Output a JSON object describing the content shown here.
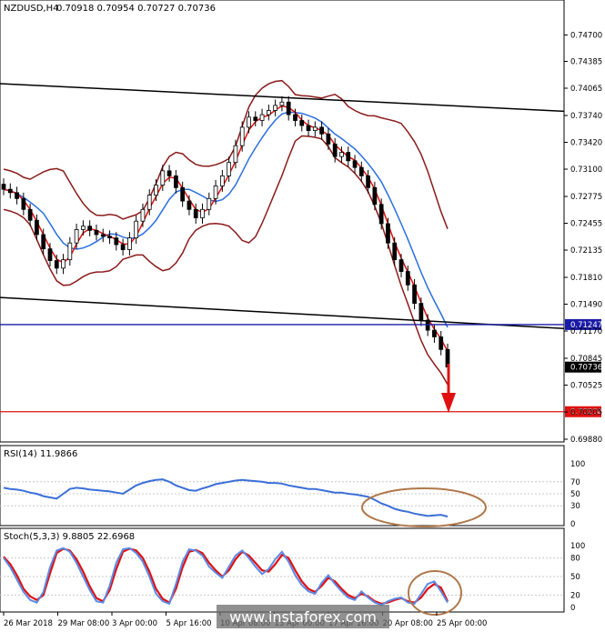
{
  "chart_data": [
    {
      "type": "candlestick",
      "title": "NZDUSD,H4",
      "ohlc_header": "0.70918 0.70954 0.70727 0.70736",
      "y_ticks": [
        "0.74700",
        "0.74385",
        "0.74065",
        "0.73740",
        "0.73420",
        "0.73100",
        "0.72775",
        "0.72455",
        "0.72135",
        "0.71810",
        "0.71490",
        "0.71170",
        "0.70845",
        "0.70525",
        "0.70205",
        "0.69880"
      ],
      "ylim": [
        0.6988,
        0.749
      ],
      "current_price_label": "0.70736",
      "horizontal_levels": [
        {
          "value": 0.71247,
          "label": "0.71247",
          "color": "#1a1aa8"
        },
        {
          "value": 0.70208,
          "label": "0.70208",
          "color": "#e01010"
        }
      ],
      "trendlines": [
        {
          "from": 0.7412,
          "to": 0.7379
        },
        {
          "from": 0.7157,
          "to": 0.712
        }
      ],
      "x_tick_labels": [
        "26 Mar 2018",
        "29 Mar 08:00",
        "3 Apr 00:00",
        "5 Apr 16:00",
        "10 Apr 08:00",
        "13 Apr 00:00",
        "17 Apr 16:00",
        "20 Apr 08:00",
        "25 Apr 00:00"
      ],
      "forecast_arrow": "down",
      "close_series": [
        0.7286,
        0.7282,
        0.7275,
        0.7262,
        0.7249,
        0.7232,
        0.7215,
        0.7201,
        0.7192,
        0.7202,
        0.7222,
        0.7238,
        0.7242,
        0.7237,
        0.7232,
        0.723,
        0.7228,
        0.722,
        0.7214,
        0.7228,
        0.7248,
        0.7262,
        0.7279,
        0.7291,
        0.7308,
        0.7302,
        0.7288,
        0.7272,
        0.7262,
        0.7252,
        0.7262,
        0.7275,
        0.729,
        0.7302,
        0.7318,
        0.7338,
        0.736,
        0.7372,
        0.7368,
        0.7375,
        0.738,
        0.7386,
        0.739,
        0.7375,
        0.7368,
        0.7362,
        0.7356,
        0.736,
        0.7352,
        0.734,
        0.7325,
        0.733,
        0.732,
        0.7312,
        0.7302,
        0.7288,
        0.7268,
        0.7245,
        0.7222,
        0.7202,
        0.7188,
        0.7172,
        0.715,
        0.713,
        0.7118,
        0.711,
        0.7095,
        0.7074
      ],
      "indicators": {
        "moving_average_colors": [
          "#e01010",
          "#2a6fe0"
        ],
        "bollinger_color": "#8b1a1a"
      }
    },
    {
      "type": "line",
      "title": "RSI(14) 11.9866",
      "y_ticks": [
        "100",
        "70",
        "50",
        "30",
        "0"
      ],
      "ylim": [
        0,
        100
      ],
      "series": [
        {
          "values": [
            60,
            58,
            57,
            55,
            52,
            50,
            46,
            44,
            42,
            50,
            58,
            60,
            59,
            57,
            56,
            55,
            54,
            52,
            50,
            57,
            64,
            68,
            71,
            73,
            74,
            70,
            64,
            60,
            56,
            55,
            59,
            62,
            66,
            68,
            70,
            72,
            73,
            72,
            71,
            70,
            68,
            68,
            67,
            64,
            62,
            60,
            58,
            58,
            56,
            54,
            52,
            52,
            50,
            49,
            47,
            45,
            40,
            34,
            30,
            25,
            22,
            20,
            17,
            15,
            13,
            14,
            15,
            12
          ],
          "color": "#3b6fd8"
        }
      ],
      "annotation": "ellipse-around-oversold-region"
    },
    {
      "type": "line",
      "title": "Stoch(5,3,3) 9.8805 22.6968",
      "y_ticks": [
        "100",
        "80",
        "50",
        "20",
        "0"
      ],
      "ylim": [
        0,
        100
      ],
      "series": [
        {
          "values": [
            82,
            70,
            52,
            30,
            18,
            12,
            20,
            55,
            88,
            95,
            92,
            78,
            58,
            34,
            15,
            10,
            28,
            62,
            90,
            95,
            92,
            80,
            58,
            30,
            14,
            8,
            30,
            65,
            90,
            93,
            88,
            72,
            60,
            50,
            60,
            78,
            90,
            84,
            72,
            60,
            58,
            70,
            85,
            80,
            60,
            42,
            30,
            25,
            35,
            48,
            42,
            30,
            20,
            15,
            22,
            18,
            10,
            6,
            8,
            12,
            15,
            10,
            8,
            16,
            30,
            38,
            32,
            10
          ],
          "color": "#e01010"
        },
        {
          "values": [
            80,
            65,
            45,
            25,
            12,
            8,
            25,
            65,
            92,
            96,
            90,
            72,
            50,
            28,
            10,
            8,
            35,
            72,
            94,
            96,
            88,
            74,
            50,
            22,
            10,
            6,
            38,
            74,
            94,
            92,
            84,
            66,
            56,
            48,
            66,
            84,
            92,
            80,
            66,
            54,
            62,
            78,
            90,
            74,
            52,
            36,
            26,
            22,
            40,
            52,
            38,
            26,
            16,
            12,
            26,
            16,
            8,
            4,
            10,
            14,
            16,
            8,
            6,
            22,
            38,
            42,
            26,
            8
          ],
          "color": "#5a8be8"
        }
      ],
      "annotation": "ellipse-around-latest-cross"
    }
  ],
  "watermark": "www.instaforex.com"
}
